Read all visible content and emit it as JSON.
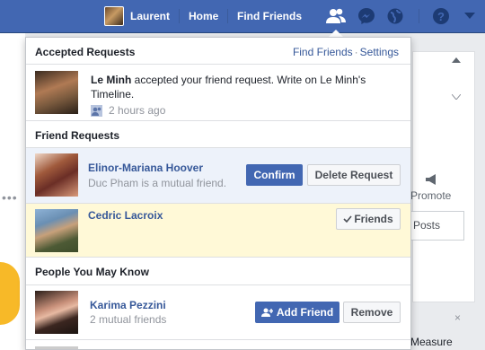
{
  "topbar": {
    "user_name": "Laurent",
    "links": [
      "Home",
      "Find Friends"
    ],
    "icons": [
      "friend-requests-icon",
      "messenger-icon",
      "notifications-globe-icon",
      "help-icon",
      "chevron-down-icon"
    ]
  },
  "background": {
    "promote_label": "Promote",
    "posts_label": "Posts",
    "measure_label": "Measure",
    "close_glyph": "×",
    "dots": "•••"
  },
  "dropdown": {
    "accepted": {
      "title": "Accepted Requests",
      "find_friends": "Find Friends",
      "separator": "·",
      "settings": "Settings",
      "name": "Le Minh",
      "message": " accepted your friend request. Write on Le Minh's Timeline.",
      "time": "2 hours ago"
    },
    "friend_requests": {
      "title": "Friend Requests",
      "items": [
        {
          "name": "Elinor-Mariana Hoover",
          "subtitle": "Duc Pham is a mutual friend.",
          "confirm": "Confirm",
          "delete": "Delete Request"
        },
        {
          "name": "Cedric Lacroix",
          "status": "Friends"
        }
      ]
    },
    "pymk": {
      "title": "People You May Know",
      "items": [
        {
          "name": "Karima Pezzini",
          "subtitle": "2 mutual friends",
          "add": "Add Friend",
          "remove": "Remove"
        }
      ]
    }
  },
  "colors": {
    "brand": "#4267b2",
    "link": "#365899",
    "highlight_blue": "#edf2fa",
    "highlight_yellow": "#fff9d7"
  }
}
